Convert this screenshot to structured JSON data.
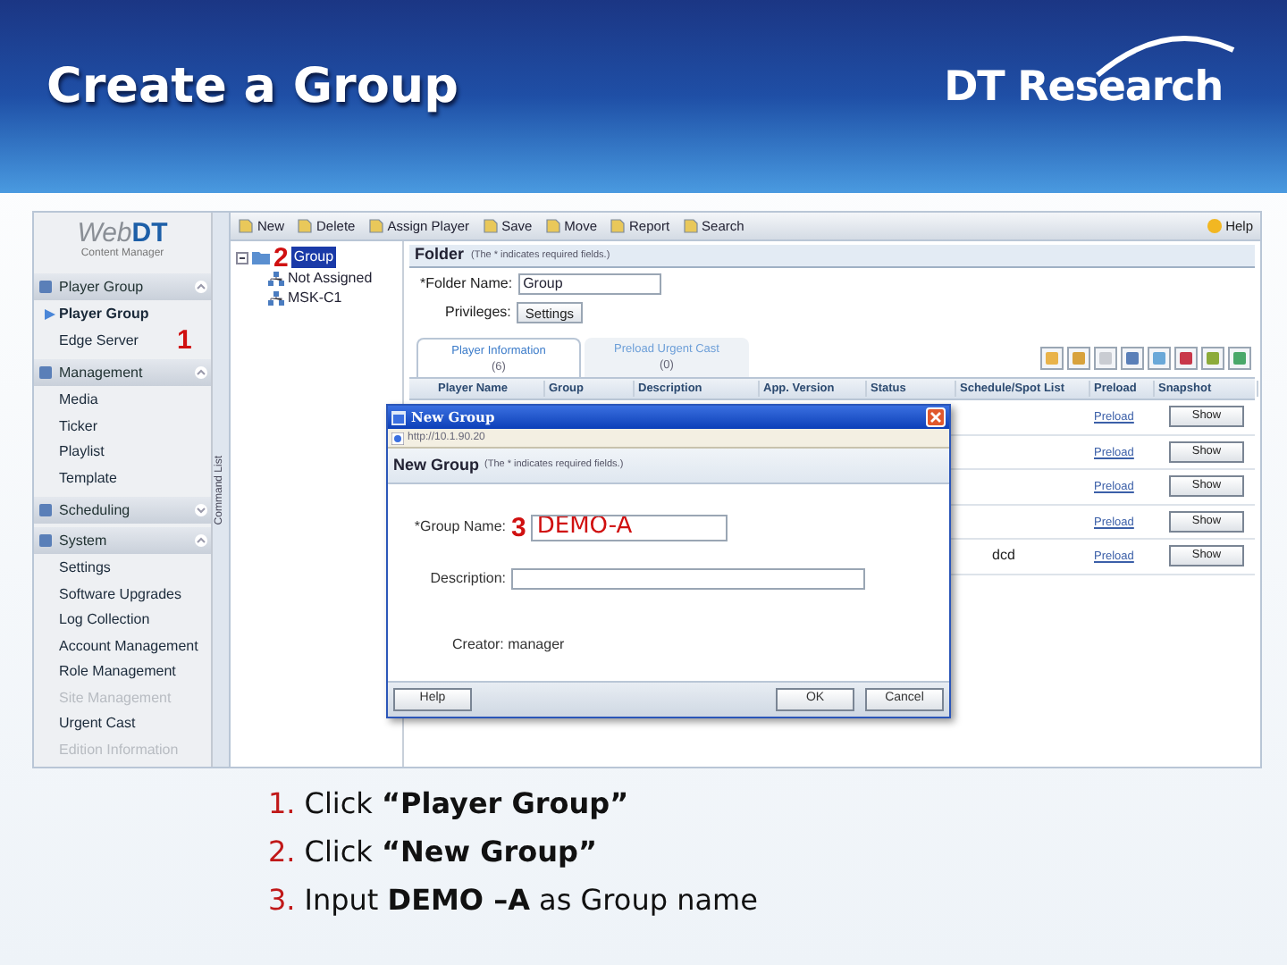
{
  "slide": {
    "title": "Create a Group",
    "brand": "DT Research"
  },
  "sidebar": {
    "logo": "Web**DT**",
    "logo_caption": "Content Manager",
    "sections": [
      {
        "label": "Player Group",
        "expanded": true,
        "items": [
          {
            "label": "Player Group",
            "selected": true,
            "disabled": false
          },
          {
            "label": "Edge Server",
            "selected": false,
            "disabled": false
          }
        ]
      },
      {
        "label": "Management",
        "expanded": true,
        "items": [
          {
            "label": "Media",
            "selected": false,
            "disabled": false
          },
          {
            "label": "Ticker",
            "selected": false,
            "disabled": false
          },
          {
            "label": "Playlist",
            "selected": false,
            "disabled": false
          },
          {
            "label": "Template",
            "selected": false,
            "disabled": false
          }
        ]
      },
      {
        "label": "Scheduling",
        "expanded": false
      },
      {
        "label": "System",
        "expanded": true,
        "items": [
          {
            "label": "Settings",
            "selected": false,
            "disabled": false
          },
          {
            "label": "Software Upgrades",
            "selected": false,
            "disabled": false
          },
          {
            "label": "Log Collection",
            "selected": false,
            "disabled": false
          },
          {
            "label": "Account Management",
            "selected": false,
            "disabled": false
          },
          {
            "label": "Role Management",
            "selected": false,
            "disabled": false
          },
          {
            "label": "Site Management",
            "selected": false,
            "disabled": true
          },
          {
            "label": "Urgent Cast",
            "selected": false,
            "disabled": false
          },
          {
            "label": "Edition Information",
            "selected": false,
            "disabled": true
          }
        ]
      }
    ]
  },
  "command_strip": "Command List",
  "toolbar": [
    "New",
    "Delete",
    "Assign Player",
    "Save",
    "Move",
    "Report",
    "Search"
  ],
  "help": "Help",
  "tree": {
    "label": "Group",
    "selected": true,
    "children": [
      {
        "label": "Not Assigned"
      },
      {
        "label": "MSK-C1"
      }
    ]
  },
  "folder": {
    "title": "Folder",
    "hint": "(The * indicates required fields.)",
    "name_label": "*Folder Name:",
    "name_value": "Group",
    "privileges_label": "Privileges:",
    "privileges_button": "Settings",
    "tabs": [
      {
        "label": "Player Information",
        "count": "(6)",
        "selected": true
      },
      {
        "label": "Preload Urgent Cast",
        "count": "(0)",
        "selected": false
      }
    ],
    "table": {
      "columns": [
        "Player Name",
        "Group",
        "Description",
        "App. Version",
        "Status",
        "Schedule/Spot List",
        "Preload",
        "Snapshot"
      ],
      "rows": [
        {
          "preload": "Preload",
          "snapshot": "Show"
        },
        {
          "preload": "Preload",
          "snapshot": "Show"
        },
        {
          "preload": "Preload",
          "snapshot": "Show"
        },
        {
          "preload": "Preload",
          "snapshot": "Show"
        },
        {
          "schedule": "dcd",
          "preload": "Preload",
          "snapshot": "Show"
        }
      ]
    }
  },
  "dialog": {
    "title": "New Group",
    "address": "http://10.1.90.20",
    "heading": "New Group",
    "hint": "(The * indicates required fields.)",
    "group_name_label": "*Group Name:",
    "group_name_value": "DEMO-A",
    "description_label": "Description:",
    "creator": "Creator: manager",
    "buttons": [
      "Help",
      "OK",
      "Cancel"
    ]
  },
  "markers": [
    "1",
    "2",
    "3"
  ],
  "steps": [
    {
      "number": "1.",
      "text": "Click **“Player Group”**"
    },
    {
      "number": "2.",
      "text": "Click **“New Group”**"
    },
    {
      "number": "3.",
      "text": "Input **DEMO –A** as Group name"
    }
  ]
}
